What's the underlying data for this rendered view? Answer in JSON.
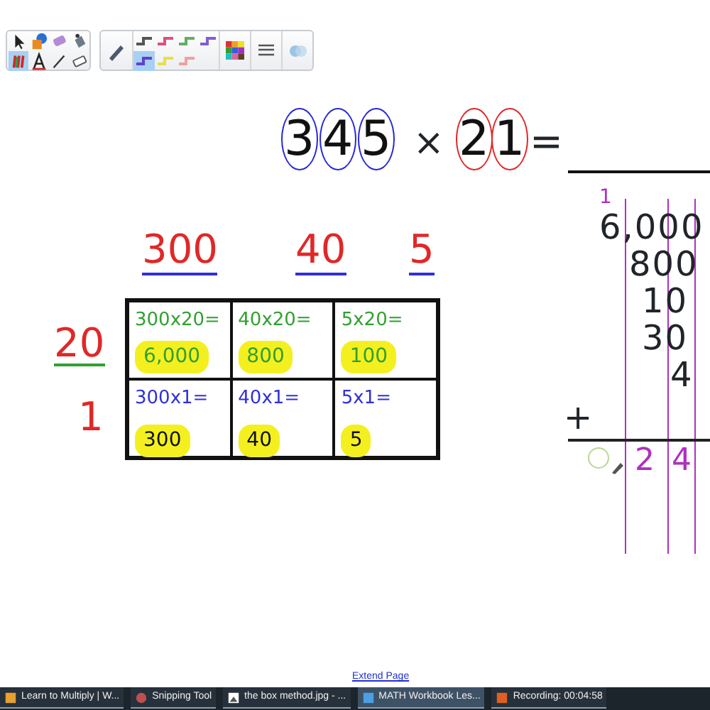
{
  "toolbar": {
    "tools": [
      {
        "selected": false
      },
      {
        "selected": false
      },
      {
        "selected": false
      },
      {
        "selected": false
      },
      {
        "selected": true
      },
      {
        "selected": false
      },
      {
        "selected": false
      },
      {
        "selected": false
      }
    ],
    "line_styles": [
      {
        "color": "#555555",
        "selected": false
      },
      {
        "color": "#e0507a",
        "selected": false
      },
      {
        "color": "#60b060",
        "selected": false
      },
      {
        "color": "#8060d0",
        "selected": false
      },
      {
        "color": "#6040d0",
        "selected": true
      },
      {
        "color": "#e8e040",
        "selected": false
      },
      {
        "color": "#f0a0a0",
        "selected": false
      }
    ]
  },
  "equation": {
    "left_digits": [
      {
        "text": "3",
        "color": "#2828d8"
      },
      {
        "text": "4",
        "color": "#2828d8"
      },
      {
        "text": "5",
        "color": "#2828d8"
      }
    ],
    "operator": "×",
    "right_digits": [
      {
        "text": "2",
        "color": "#e02828"
      },
      {
        "text": "1",
        "color": "#e02828"
      }
    ],
    "equals": "="
  },
  "column_headers": [
    "300",
    "40",
    "5"
  ],
  "rows": [
    {
      "label": "20",
      "color": "#30a030",
      "cells": [
        {
          "expression": "300x20=",
          "answer": "6,000"
        },
        {
          "expression": "40x20=",
          "answer": "800"
        },
        {
          "expression": "5x20=",
          "answer": "100"
        }
      ]
    },
    {
      "label": "1",
      "color": "#3030d8",
      "cells": [
        {
          "expression": "300x1=",
          "answer": "300"
        },
        {
          "expression": "40x1=",
          "answer": "40"
        },
        {
          "expression": "5x1=",
          "answer": "5"
        }
      ]
    }
  ],
  "addition": {
    "carry": "1",
    "addends": [
      "6,000",
      "800",
      "10",
      "30",
      "4"
    ],
    "plus": "+",
    "result": [
      "2",
      "4"
    ]
  },
  "extend_page_link": "Extend Page",
  "taskbar": [
    {
      "label": "Learn to Multiply | W...",
      "active": false
    },
    {
      "label": "Snipping Tool",
      "active": false
    },
    {
      "label": "the box method.jpg - ...",
      "active": false
    },
    {
      "label": "MATH Workbook Les...",
      "active": true
    },
    {
      "label": "Recording: 00:04:58",
      "active": false
    }
  ]
}
